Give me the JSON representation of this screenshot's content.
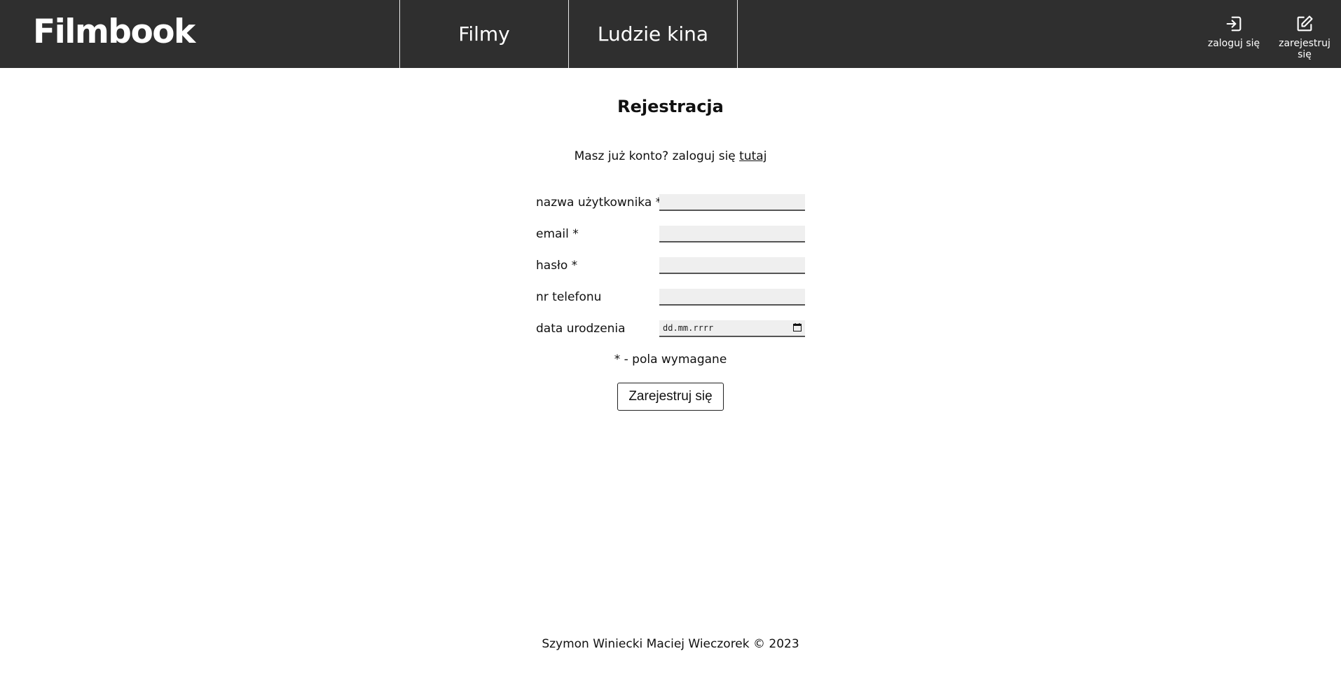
{
  "header": {
    "logo": "Filmbook",
    "nav": [
      {
        "label": "Filmy"
      },
      {
        "label": "Ludzie kina"
      }
    ],
    "account": {
      "login_label": "zaloguj się",
      "login_icon": "login-icon",
      "register_label": "zarejestruj się",
      "register_icon": "edit-icon"
    },
    "colors": {
      "background": "#2f2f2f",
      "text": "#ffffff"
    }
  },
  "form": {
    "title": "Rejestracja",
    "login_prompt": "Masz już konto? zaloguj się",
    "login_link": "tutaj",
    "fields": [
      {
        "label": "nazwa użytkownika *",
        "value": ""
      },
      {
        "label": "email *",
        "value": ""
      },
      {
        "label": "hasło *",
        "value": ""
      },
      {
        "label": "nr telefonu",
        "value": ""
      },
      {
        "label": "data urodzenia",
        "placeholder": "dd.mm.rrrr"
      }
    ],
    "required_note": "* - pola wymagane",
    "submit_label": "Zarejestruj się"
  },
  "footer": {
    "text": "Szymon Winiecki Maciej Wieczorek © 2023"
  }
}
